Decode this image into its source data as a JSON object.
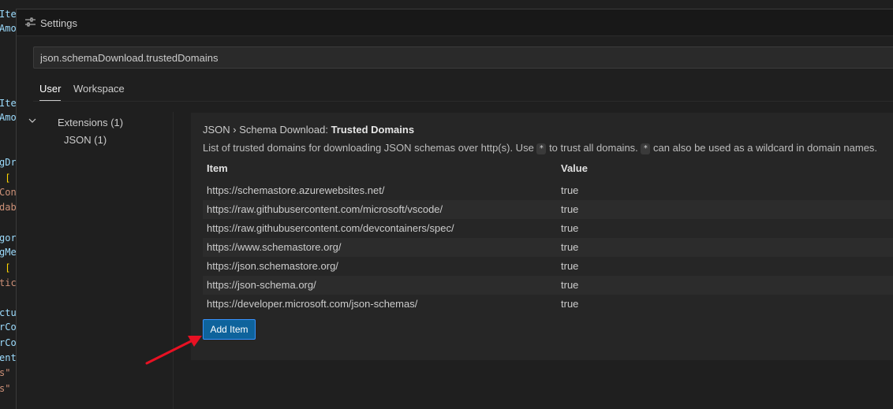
{
  "background_code": {
    "lines": [
      {
        "text": "Ite",
        "color": "#9cdcfe"
      },
      {
        "text": "Amo",
        "color": "#9cdcfe"
      },
      {
        "text": "Ite",
        "color": "#9cdcfe"
      },
      {
        "text": "Amo",
        "color": "#9cdcfe"
      },
      {
        "text": "gDr",
        "color": "#9cdcfe"
      },
      {
        "text": " [",
        "color": "#ffd700"
      },
      {
        "text": "Con",
        "color": "#ce9178"
      },
      {
        "text": "dab",
        "color": "#ce9178"
      },
      {
        "text": "gor",
        "color": "#9cdcfe"
      },
      {
        "text": "gMe",
        "color": "#9cdcfe"
      },
      {
        "text": " [",
        "color": "#ffd700"
      },
      {
        "text": "tic",
        "color": "#ce9178"
      },
      {
        "text": "ctu",
        "color": "#9cdcfe"
      },
      {
        "text": "rCo",
        "color": "#9cdcfe"
      },
      {
        "text": "rCo",
        "color": "#9cdcfe"
      },
      {
        "text": "ent",
        "color": "#9cdcfe"
      },
      {
        "text": "s\"",
        "color": "#ce9178"
      },
      {
        "text": "s\"",
        "color": "#ce9178"
      }
    ]
  },
  "tab": {
    "icon": "settings-sliders-icon",
    "title": "Settings"
  },
  "search": {
    "value": "json.schemaDownload.trustedDomains",
    "placeholder": ""
  },
  "scope_tabs": [
    {
      "label": "User",
      "active": true
    },
    {
      "label": "Workspace",
      "active": false
    }
  ],
  "toc": {
    "group_label": "Extensions (1)",
    "child_label": "JSON (1)"
  },
  "setting": {
    "title_prefix": "JSON › Schema Download: ",
    "title_name": "Trusted Domains",
    "desc_part1": "List of trusted domains for downloading JSON schemas over http(s). Use ",
    "desc_chip1": "*",
    "desc_part2": " to trust all domains. ",
    "desc_chip2": "*",
    "desc_part3": " can also be used as a wildcard in domain names.",
    "columns": {
      "item": "Item",
      "value": "Value"
    },
    "rows": [
      {
        "item": "https://schemastore.azurewebsites.net/",
        "value": "true"
      },
      {
        "item": "https://raw.githubusercontent.com/microsoft/vscode/",
        "value": "true"
      },
      {
        "item": "https://raw.githubusercontent.com/devcontainers/spec/",
        "value": "true"
      },
      {
        "item": "https://www.schemastore.org/",
        "value": "true"
      },
      {
        "item": "https://json.schemastore.org/",
        "value": "true"
      },
      {
        "item": "https://json-schema.org/",
        "value": "true"
      },
      {
        "item": "https://developer.microsoft.com/json-schemas/",
        "value": "true"
      }
    ],
    "add_button": "Add Item"
  },
  "annotation": {
    "arrow_color": "#e81123"
  }
}
